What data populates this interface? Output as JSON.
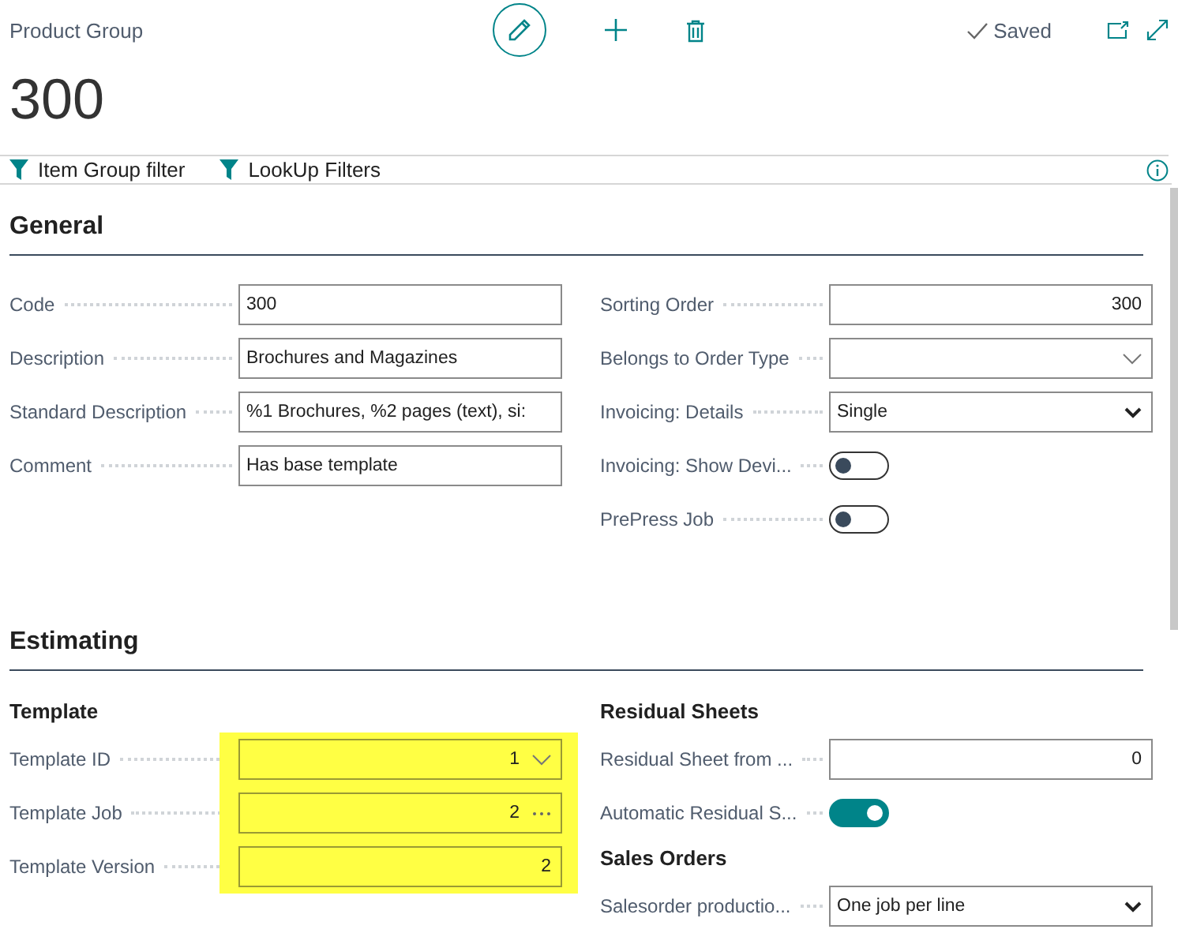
{
  "header": {
    "caption": "Product Group",
    "title": "300",
    "status": "Saved"
  },
  "filters": [
    {
      "label": "Item Group filter"
    },
    {
      "label": "LookUp Filters"
    }
  ],
  "sections": [
    {
      "title": "General",
      "columns": [
        {
          "groups": [
            {
              "highlighted": false,
              "fields": [
                {
                  "kind": "text",
                  "label": "Code",
                  "value": "300",
                  "right_aligned": false
                },
                {
                  "kind": "text",
                  "label": "Description",
                  "value": "Brochures and Magazines",
                  "right_aligned": false
                },
                {
                  "kind": "text",
                  "label": "Standard Description",
                  "value": "%1 Brochures, %2 pages (text), si:",
                  "right_aligned": false
                },
                {
                  "kind": "text",
                  "label": "Comment",
                  "value": "Has base template",
                  "right_aligned": false
                }
              ]
            }
          ]
        },
        {
          "groups": [
            {
              "highlighted": false,
              "fields": [
                {
                  "kind": "text",
                  "label": "Sorting Order",
                  "value": "300",
                  "right_aligned": true
                },
                {
                  "kind": "lookup",
                  "label": "Belongs to Order Type"
                },
                {
                  "kind": "select",
                  "label": "Invoicing: Details",
                  "value": "Single",
                  "right_aligned": false
                },
                {
                  "kind": "toggle",
                  "label": "Invoicing: Show Devi...",
                  "on": false
                },
                {
                  "kind": "toggle",
                  "label": "PrePress Job",
                  "on": false
                }
              ]
            }
          ]
        }
      ]
    },
    {
      "title": "Estimating",
      "columns": [
        {
          "groups": [
            {
              "title": "Template",
              "highlighted": true,
              "fields": [
                {
                  "kind": "lookup",
                  "label": "Template ID",
                  "value": "1",
                  "right_aligned": true
                },
                {
                  "kind": "assist",
                  "label": "Template Job",
                  "value": "2",
                  "right_aligned": true
                },
                {
                  "kind": "text",
                  "label": "Template Version",
                  "value": "2",
                  "right_aligned": true
                }
              ]
            }
          ]
        },
        {
          "groups": [
            {
              "title": "Residual Sheets",
              "highlighted": false,
              "fields": [
                {
                  "kind": "text",
                  "label": "Residual Sheet from ...",
                  "value": "0",
                  "right_aligned": true
                },
                {
                  "kind": "toggle",
                  "label": "Automatic Residual S...",
                  "on": true
                }
              ]
            },
            {
              "title": "Sales Orders",
              "highlighted": false,
              "fields": [
                {
                  "kind": "select",
                  "label": "Salesorder productio...",
                  "value": "One job per line",
                  "right_aligned": false
                }
              ]
            }
          ]
        }
      ]
    }
  ]
}
